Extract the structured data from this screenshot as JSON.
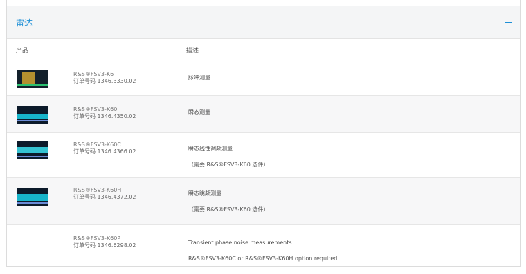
{
  "section": {
    "title": "雷达"
  },
  "columns": {
    "product": "产品",
    "description": "描述"
  },
  "rows": [
    {
      "name": "R&S®FSV3-K6",
      "order": "订单号码 1346.3330.02",
      "desc1": "脉冲测量",
      "desc2": ""
    },
    {
      "name": "R&S®FSV3-K60",
      "order": "订单号码 1346.4350.02",
      "desc1": "瞬态测量",
      "desc2": ""
    },
    {
      "name": "R&S®FSV3-K60C",
      "order": "订单号码 1346.4366.02",
      "desc1": "瞬态线性调频测量",
      "desc2": "（需要 R&S®FSV3-K60 选件）"
    },
    {
      "name": "R&S®FSV3-K60H",
      "order": "订单号码 1346.4372.02",
      "desc1": "瞬态跳频测量",
      "desc2": "（需要 R&S®FSV3-K60 选件）"
    },
    {
      "name": "R&S®FSV3-K60P",
      "order": "订单号码 1346.6298.02",
      "desc1": "Transient phase noise measurements",
      "desc2": "R&S®FSV3-K60C or R&S®FSV3-K60H option required."
    }
  ]
}
